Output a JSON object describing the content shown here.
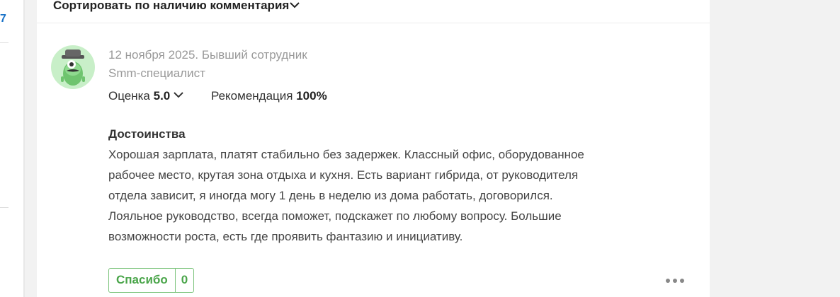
{
  "left_panel": {
    "number": "7"
  },
  "sort": {
    "label": "Сортировать по наличию комментария"
  },
  "review": {
    "date_status": "12 ноября 2025. Бывший сотрудник",
    "position": "Smm-специалист",
    "rating_label": "Оценка",
    "rating_value": "5.0",
    "recommendation_label": "Рекомендация",
    "recommendation_value": "100%",
    "pros_title": "Достоинства",
    "pros_lines": [
      "Хорошая зарплата, платят стабильно без задержек. Классный офис, оборудованное",
      "рабочее место, крутая зона отдыха и кухня. Есть вариант гибрида, от руководителя",
      "отдела зависит, я иногда могу 1 день в неделю из дома работать, договорился.",
      "Лояльное руководство, всегда поможет, подскажет по любому вопросу. Большие",
      "возможности роста, есть где проявить фантазию и инициативу."
    ],
    "thanks_label": "Спасибо",
    "thanks_count": "0"
  },
  "icons": {
    "avatar": "spy-mascot-avatar",
    "sort_chevron": "chevron-down-icon",
    "rating_chevron": "chevron-down-icon",
    "more": "more-dots-icon"
  },
  "colors": {
    "link_blue": "#1a73c8",
    "green": "#4aa54a",
    "avatar_bg": "#c8efc8"
  }
}
